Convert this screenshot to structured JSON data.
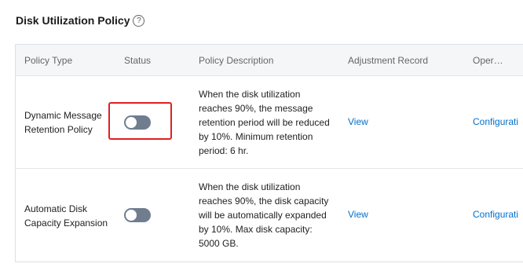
{
  "page_title": "Disk Utilization Policy",
  "help_icon_glyph": "?",
  "table": {
    "headers": {
      "policy_type": "Policy Type",
      "status": "Status",
      "policy_description": "Policy Description",
      "adjustment_record": "Adjustment Record",
      "operation": "Oper…"
    },
    "rows": [
      {
        "policy_type_line1": "Dynamic Message",
        "policy_type_line2": "Retention Policy",
        "status_enabled": false,
        "description_lines": [
          "When the disk utilization",
          "reaches 90%, the message",
          "retention period will be reduced",
          "by 10%. Minimum retention",
          "period: 6 hr."
        ],
        "adjustment_record_link": "View",
        "operation_link": "Configurati"
      },
      {
        "policy_type_line1": "Automatic Disk",
        "policy_type_line2": "Capacity Expansion",
        "status_enabled": false,
        "description_lines": [
          "When the disk utilization",
          "reaches 90%, the disk capacity",
          "will be automatically expanded",
          "by 10%. Max disk capacity:",
          "5000 GB."
        ],
        "adjustment_record_link": "View",
        "operation_link": "Configurati"
      }
    ]
  },
  "colors": {
    "toggle_off": "#6f7d8f",
    "link": "#0070cc",
    "highlight": "#e02020",
    "header_bg": "#f5f6f8"
  }
}
